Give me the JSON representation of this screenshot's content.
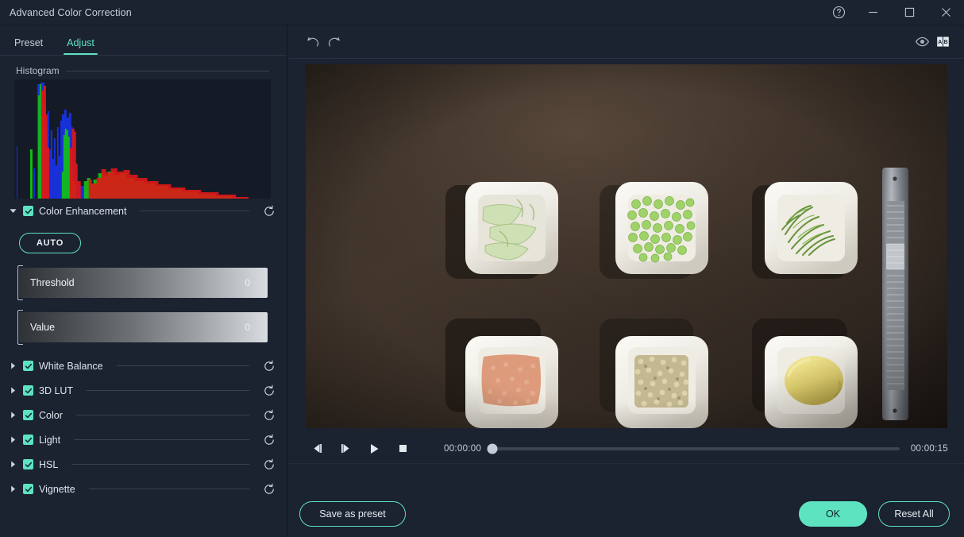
{
  "window": {
    "title": "Advanced Color Correction",
    "controls": [
      {
        "name": "help-button",
        "glyph": "help"
      },
      {
        "name": "minimize-button",
        "glyph": "minimize"
      },
      {
        "name": "maximize-button",
        "glyph": "maximize"
      },
      {
        "name": "close-button",
        "glyph": "close"
      }
    ]
  },
  "left_panel": {
    "tabs": [
      {
        "label": "Preset",
        "active": false
      },
      {
        "label": "Adjust",
        "active": true
      }
    ],
    "histogram": {
      "title": "Histogram",
      "channels": [
        "red",
        "green",
        "blue"
      ]
    },
    "color_enhancement": {
      "label": "Color Enhancement",
      "checked": true,
      "expanded": true,
      "auto_label": "AUTO",
      "reset_icon": "reset-icon",
      "sliders": [
        {
          "label": "Threshold",
          "value": "0"
        },
        {
          "label": "Value",
          "value": "0"
        }
      ]
    },
    "sections": [
      {
        "label": "White Balance",
        "checked": true,
        "expanded": false
      },
      {
        "label": "3D LUT",
        "checked": true,
        "expanded": false
      },
      {
        "label": "Color",
        "checked": true,
        "expanded": false
      },
      {
        "label": "Light",
        "checked": true,
        "expanded": false
      },
      {
        "label": "HSL",
        "checked": true,
        "expanded": false
      },
      {
        "label": "Vignette",
        "checked": true,
        "expanded": false
      }
    ]
  },
  "toolbar": {
    "undo_icon": "undo-icon",
    "redo_icon": "redo-icon",
    "preview_toggle_icon": "eye-icon",
    "compare_icon": "compare-ab-icon"
  },
  "preview": {
    "description": "Top-down food photo: white square bowls with cucumber ribbons, green peas, dill, salmon roe paste, crumbled nuts, a lemon, and a metal zester on a dark brown surface"
  },
  "transport": {
    "prev_frame_icon": "prev-frame-icon",
    "next_frame_icon": "next-frame-icon",
    "play_icon": "play-icon",
    "stop_icon": "stop-icon",
    "current_time": "00:00:00",
    "total_time": "00:00:15",
    "progress_percent": 0
  },
  "footer": {
    "save_preset_label": "Save as preset",
    "ok_label": "OK",
    "reset_all_label": "Reset All"
  },
  "colors": {
    "accent": "#5ee3c0",
    "panel_bg": "#1b2230",
    "canvas_bg": "#151b26",
    "text": "#d6dbe4"
  }
}
